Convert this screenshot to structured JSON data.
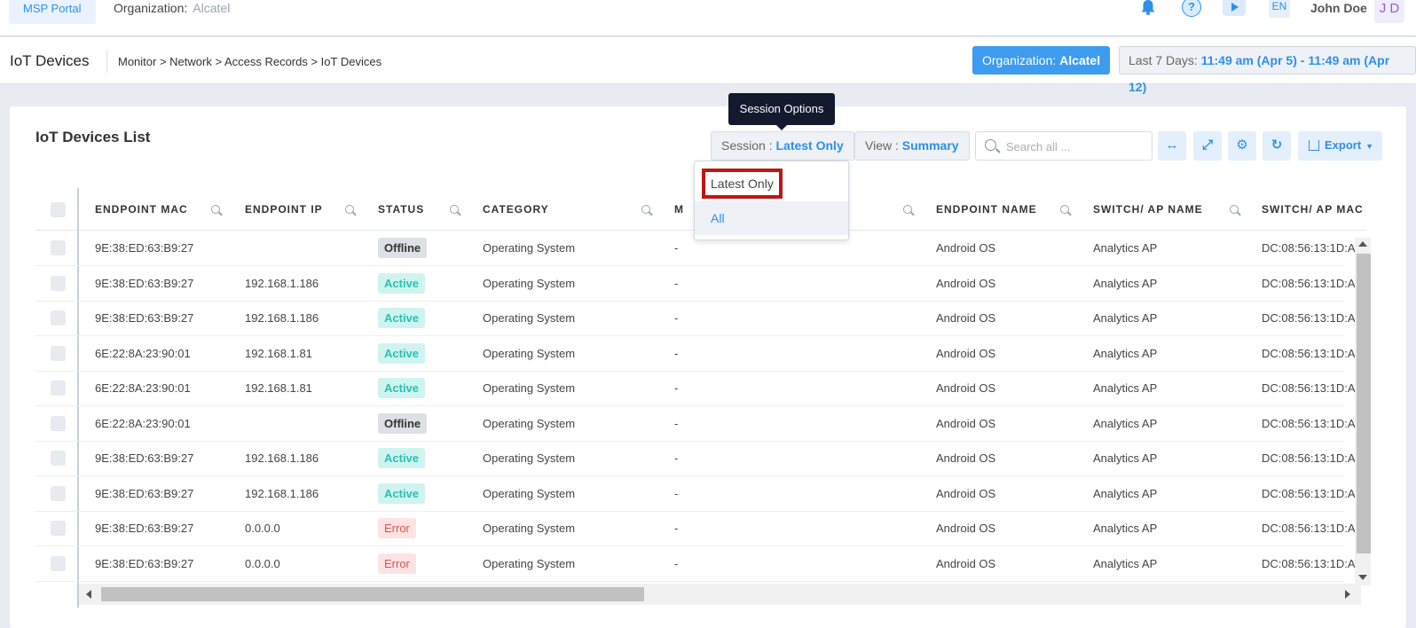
{
  "topbar": {
    "portal_label": "MSP Portal",
    "org_label": "Organization:",
    "org_value": "Alcatel",
    "lang": "EN",
    "user_name": "John Doe",
    "avatar_initials": "J D",
    "icons": [
      "bell-icon",
      "help-icon",
      "play-icon"
    ]
  },
  "subheader": {
    "page_title": "IoT Devices",
    "breadcrumb": "Monitor > Network > Access Records > IoT Devices",
    "org_chip_label": "Organization:",
    "org_chip_value": "Alcatel",
    "date_label": "Last 7 Days:",
    "date_value": "11:49 am (Apr 5) - 11:49 am (Apr 12)"
  },
  "card": {
    "title": "IoT Devices List",
    "session_label": "Session :",
    "session_value": "Latest Only",
    "view_label": "View :",
    "view_value": "Summary",
    "search_placeholder": "Search all ...",
    "export_label": "Export",
    "tooltip": "Session Options",
    "dropdown": [
      "Latest Only",
      "All"
    ]
  },
  "colors": {
    "accent": "#2f8fe8",
    "active": "#2ac0b4",
    "error": "#e05252",
    "highlight": "#c01515"
  },
  "table": {
    "headers": [
      "ENDPOINT MAC",
      "ENDPOINT IP",
      "STATUS",
      "CATEGORY",
      "M",
      "ENDPOINT NAME",
      "SWITCH/ AP NAME",
      "SWITCH/ AP MAC"
    ],
    "rows": [
      [
        "9E:38:ED:63:B9:27",
        "",
        "Offline",
        "Operating System",
        "-",
        "Android OS",
        "Analytics AP",
        "DC:08:56:13:1D:A"
      ],
      [
        "9E:38:ED:63:B9:27",
        "192.168.1.186",
        "Active",
        "Operating System",
        "-",
        "Android OS",
        "Analytics AP",
        "DC:08:56:13:1D:A"
      ],
      [
        "9E:38:ED:63:B9:27",
        "192.168.1.186",
        "Active",
        "Operating System",
        "-",
        "Android OS",
        "Analytics AP",
        "DC:08:56:13:1D:A"
      ],
      [
        "6E:22:8A:23:90:01",
        "192.168.1.81",
        "Active",
        "Operating System",
        "-",
        "Android OS",
        "Analytics AP",
        "DC:08:56:13:1D:A"
      ],
      [
        "6E:22:8A:23:90:01",
        "192.168.1.81",
        "Active",
        "Operating System",
        "-",
        "Android OS",
        "Analytics AP",
        "DC:08:56:13:1D:A"
      ],
      [
        "6E:22:8A:23:90:01",
        "",
        "Offline",
        "Operating System",
        "-",
        "Android OS",
        "Analytics AP",
        "DC:08:56:13:1D:A"
      ],
      [
        "9E:38:ED:63:B9:27",
        "192.168.1.186",
        "Active",
        "Operating System",
        "-",
        "Android OS",
        "Analytics AP",
        "DC:08:56:13:1D:A"
      ],
      [
        "9E:38:ED:63:B9:27",
        "192.168.1.186",
        "Active",
        "Operating System",
        "-",
        "Android OS",
        "Analytics AP",
        "DC:08:56:13:1D:A"
      ],
      [
        "9E:38:ED:63:B9:27",
        "0.0.0.0",
        "Error",
        "Operating System",
        "-",
        "Android OS",
        "Analytics AP",
        "DC:08:56:13:1D:A"
      ],
      [
        "9E:38:ED:63:B9:27",
        "0.0.0.0",
        "Error",
        "Operating System",
        "-",
        "Android OS",
        "Analytics AP",
        "DC:08:56:13:1D:A"
      ]
    ]
  }
}
